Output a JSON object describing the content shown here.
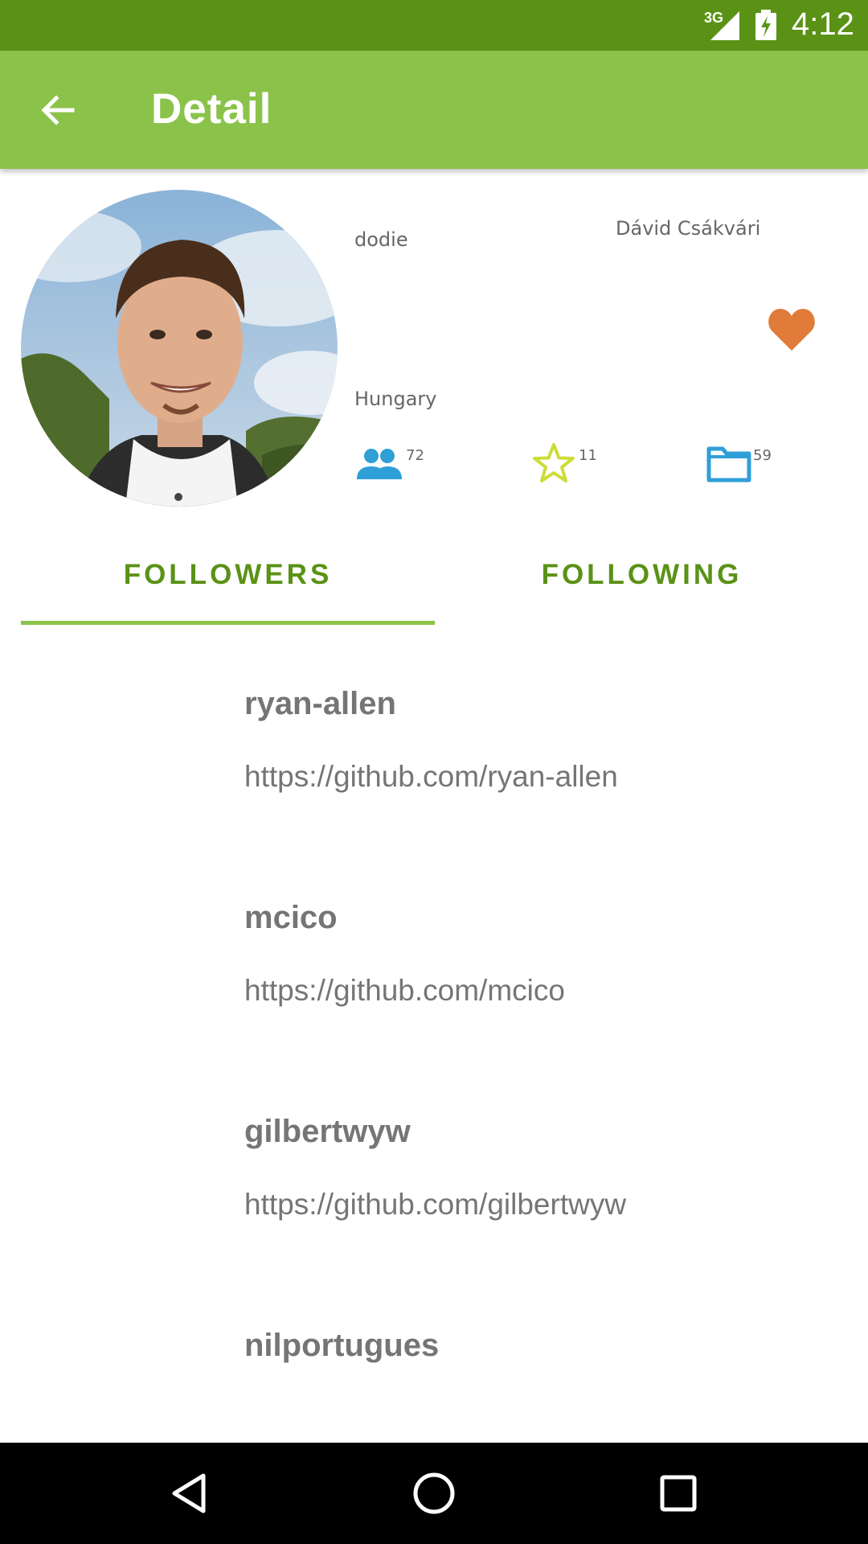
{
  "status_bar": {
    "network": "3G",
    "time": "4:12",
    "icons": [
      "signal-icon",
      "battery-charging-icon"
    ]
  },
  "app_bar": {
    "title": "Detail",
    "back_icon": "arrow-back-icon"
  },
  "profile": {
    "login": "dodie",
    "full_name": "Dávid Csákvári",
    "location": "Hungary",
    "favorite_icon": "heart-icon",
    "stats": {
      "followers": "72",
      "stars": "11",
      "repos": "59"
    }
  },
  "tabs": [
    {
      "label": "FOLLOWERS",
      "selected": true
    },
    {
      "label": "FOLLOWING",
      "selected": false
    }
  ],
  "users": [
    {
      "name": "ryan-allen",
      "url": "https://github.com/ryan-allen"
    },
    {
      "name": "mcico",
      "url": "https://github.com/mcico"
    },
    {
      "name": "gilbertwyw",
      "url": "https://github.com/gilbertwyw"
    },
    {
      "name": "nilportugues",
      "url": ""
    }
  ],
  "colors": {
    "status_bar": "#5a9216",
    "app_bar": "#8bc34a",
    "accent": "#5a9216",
    "heart": "#e07b39",
    "stat_blue": "#2f9fd8",
    "star_yellow": "#cddc39"
  }
}
